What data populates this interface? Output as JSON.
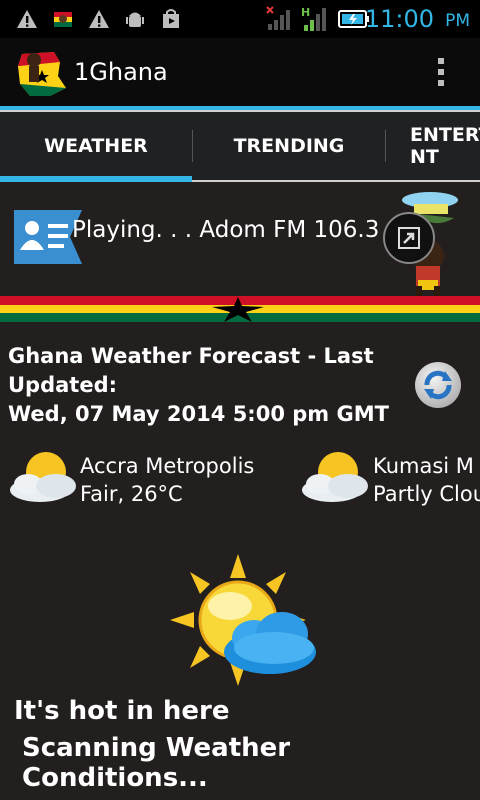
{
  "status_bar": {
    "time": "11:00",
    "ampm": "PM",
    "accent_color": "#33b5e5",
    "icons": [
      "warning-icon",
      "app-flag-icon",
      "warning-icon",
      "android-debug-icon",
      "shopping-bag-icon",
      "signal-no-service-icon",
      "signal-h-icon",
      "battery-icon"
    ]
  },
  "app": {
    "title": "1Ghana"
  },
  "tabs": [
    {
      "label": "WEATHER",
      "selected": true
    },
    {
      "label": "TRENDING",
      "selected": false
    },
    {
      "label": "ENTERT\nNT",
      "selected": false
    }
  ],
  "player": {
    "status_text": "Playing. . . Adom FM 106.3"
  },
  "forecast": {
    "title": "Ghana Weather Forecast - Last Updated:\nWed, 07 May 2014 5:00 pm GMT",
    "cities": [
      {
        "name": "Accra Metropolis",
        "condition": "Fair, 26°C",
        "icon": "partly-cloudy-icon"
      },
      {
        "name": "Kumasi M",
        "condition": "Partly Clou",
        "icon": "partly-cloudy-icon"
      }
    ]
  },
  "messages": {
    "line1": "It's hot in here",
    "line2": "Scanning Weather Conditions..."
  }
}
